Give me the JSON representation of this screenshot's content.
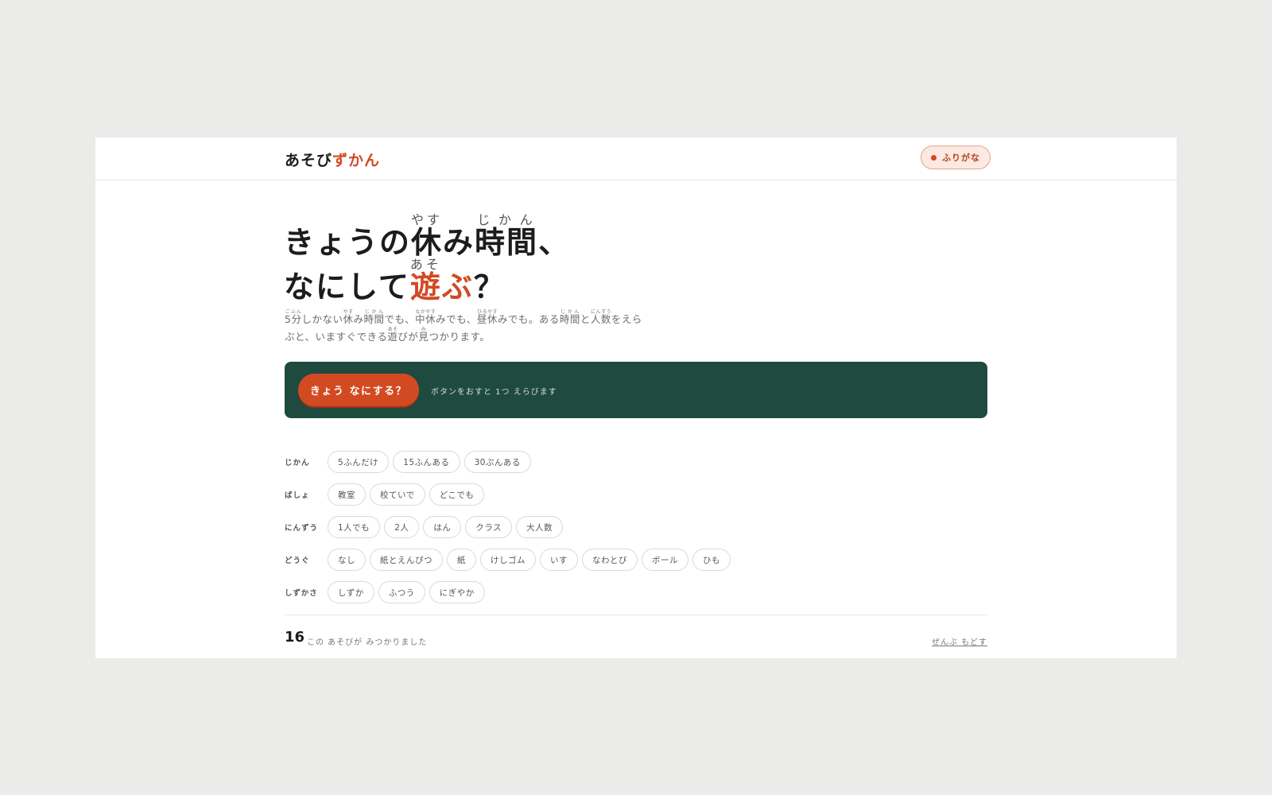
{
  "header": {
    "logo_a": "あそび",
    "logo_b": "ずかん",
    "furigana_toggle": "ふりがな"
  },
  "hero": {
    "line1_a": "きょうの",
    "line1_b": "休",
    "line1_b_ruby": "やす",
    "line1_c": "み",
    "line1_d": "時間",
    "line1_d_ruby": "じかん",
    "line1_e": "、",
    "line2_a": "なにして",
    "line2_b": "遊",
    "line2_b_ruby": "あそ",
    "line2_c": "ぶ",
    "line2_d": "？"
  },
  "lead": {
    "segments": [
      {
        "base": "5分",
        "ruby": "ごふん"
      },
      {
        "text": "しかない"
      },
      {
        "base": "休",
        "ruby": "やす"
      },
      {
        "text": "み"
      },
      {
        "base": "時間",
        "ruby": "じかん"
      },
      {
        "text": "でも、"
      },
      {
        "base": "中休",
        "ruby": "なかやす"
      },
      {
        "text": "みでも、"
      },
      {
        "base": "昼休",
        "ruby": "ひるやす"
      },
      {
        "text": "みでも。ある"
      },
      {
        "base": "時間",
        "ruby": "じかん"
      },
      {
        "text": "と"
      },
      {
        "base": "人数",
        "ruby": "にんずう"
      },
      {
        "text": "をえらぶと、いますぐできる"
      },
      {
        "base": "遊",
        "ruby": "あそ"
      },
      {
        "text": "びが"
      },
      {
        "base": "見",
        "ruby": "み"
      },
      {
        "text": "つかります。"
      }
    ]
  },
  "panel": {
    "main_button": "きょう なにする？",
    "hint": "ボタンをおすと 1つ えらびます",
    "bg_color": "#1e4a3f",
    "button_color": "#d24a22"
  },
  "filters": [
    {
      "label": "じかん",
      "chips": [
        "5ふんだけ",
        "15ふんある",
        "30ぷんある"
      ]
    },
    {
      "label": "ばしょ",
      "chips": [
        "教室",
        "校ていで",
        "どこでも"
      ]
    },
    {
      "label": "にんずう",
      "chips": [
        "1人でも",
        "2人",
        "はん",
        "クラス",
        "大人数"
      ]
    },
    {
      "label": "どうぐ",
      "chips": [
        "なし",
        "紙とえんぴつ",
        "紙",
        "けしゴム",
        "いす",
        "なわとび",
        "ボール",
        "ひも"
      ]
    },
    {
      "label": "しずかさ",
      "chips": [
        "しずか",
        "ふつう",
        "にぎやか"
      ]
    }
  ],
  "footer": {
    "count": "16",
    "count_text": "この あそびが みつかりました",
    "reset": "ぜんぶ もどす"
  }
}
